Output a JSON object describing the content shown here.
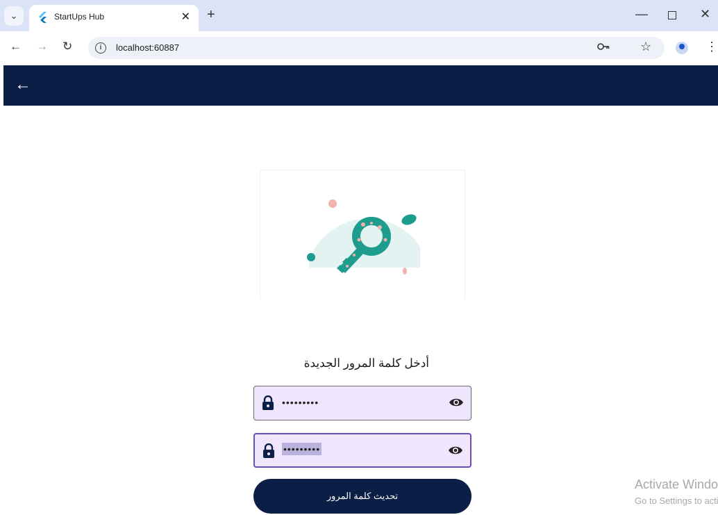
{
  "browser": {
    "tab_title": "StartUps Hub",
    "tab_close": "✕",
    "new_tab": "+",
    "url": "localhost:60887",
    "window_minimize": "—",
    "window_close": "✕",
    "icons": [
      "tab-search-icon",
      "flutter-logo-icon",
      "back-icon",
      "forward-icon",
      "reload-icon",
      "info-icon",
      "key-icon",
      "star-icon",
      "profile-icon",
      "menu-icon"
    ]
  },
  "appbar": {
    "back_icon": "arrow-left-icon",
    "background": "#0b1e46"
  },
  "form": {
    "heading": "أدخل كلمة المرور الجديدة",
    "password_value": "•••••••••",
    "confirm_value": "•••••••••",
    "field_fill": "#efe5fc",
    "focus_border": "#6a4fb3",
    "submit_label": "تحديث كلمة المرور"
  },
  "watermark": {
    "title": "Activate Windows",
    "subtitle": "Go to Settings to activate Windows."
  }
}
